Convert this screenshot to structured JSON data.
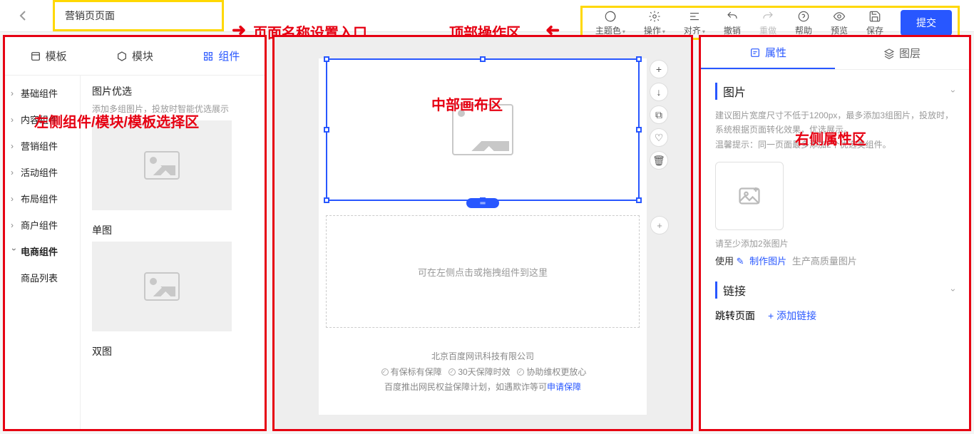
{
  "page": {
    "title_input": "营销页页面"
  },
  "annotations": {
    "title_entry": "页面名称设置入口",
    "top_ops": "顶部操作区",
    "left_panel": "左侧组件/模块/模板选择区",
    "canvas": "中部画布区",
    "right_panel": "右侧属性区"
  },
  "toolbar": {
    "theme": "主题色",
    "ops": "操作",
    "align": "对齐",
    "undo": "撤销",
    "redo": "重做",
    "help": "帮助",
    "preview": "预览",
    "save": "保存",
    "submit": "提交"
  },
  "left": {
    "tabs": {
      "template": "模板",
      "module": "模块",
      "component": "组件"
    },
    "cats": [
      "基础组件",
      "内容组件",
      "营销组件",
      "活动组件",
      "布局组件",
      "商户组件",
      "电商组件"
    ],
    "cat_sub": "商品列表",
    "comps": [
      {
        "title": "图片优选",
        "desc": "添加多组图片，投放时智能优选展示"
      },
      {
        "title": "单图",
        "desc": ""
      },
      {
        "title": "双图",
        "desc": ""
      }
    ]
  },
  "canvas": {
    "drop_hint": "可在左侧点击或拖拽组件到这里",
    "footer": {
      "company": "北京百度网讯科技有限公司",
      "badges": [
        "有保标有保障",
        "30天保障时效",
        "协助维权更放心"
      ],
      "line2": "百度推出网民权益保障计划，如遇欺诈等可",
      "link": "申请保障"
    }
  },
  "right": {
    "tabs": {
      "props": "属性",
      "layers": "图层"
    },
    "image": {
      "title": "图片",
      "desc": "建议图片宽度尺寸不低于1200px，最多添加3组图片，投放时，系统根据页面转化效果，优选展示。\n温馨提示：同一页面最多添加2个优选类组件。",
      "min_hint": "请至少添加2张图片",
      "use": "使用",
      "make": "制作图片",
      "gen": "生产高质量图片"
    },
    "link": {
      "title": "链接",
      "jump": "跳转页面",
      "add": "+ 添加链接"
    }
  }
}
